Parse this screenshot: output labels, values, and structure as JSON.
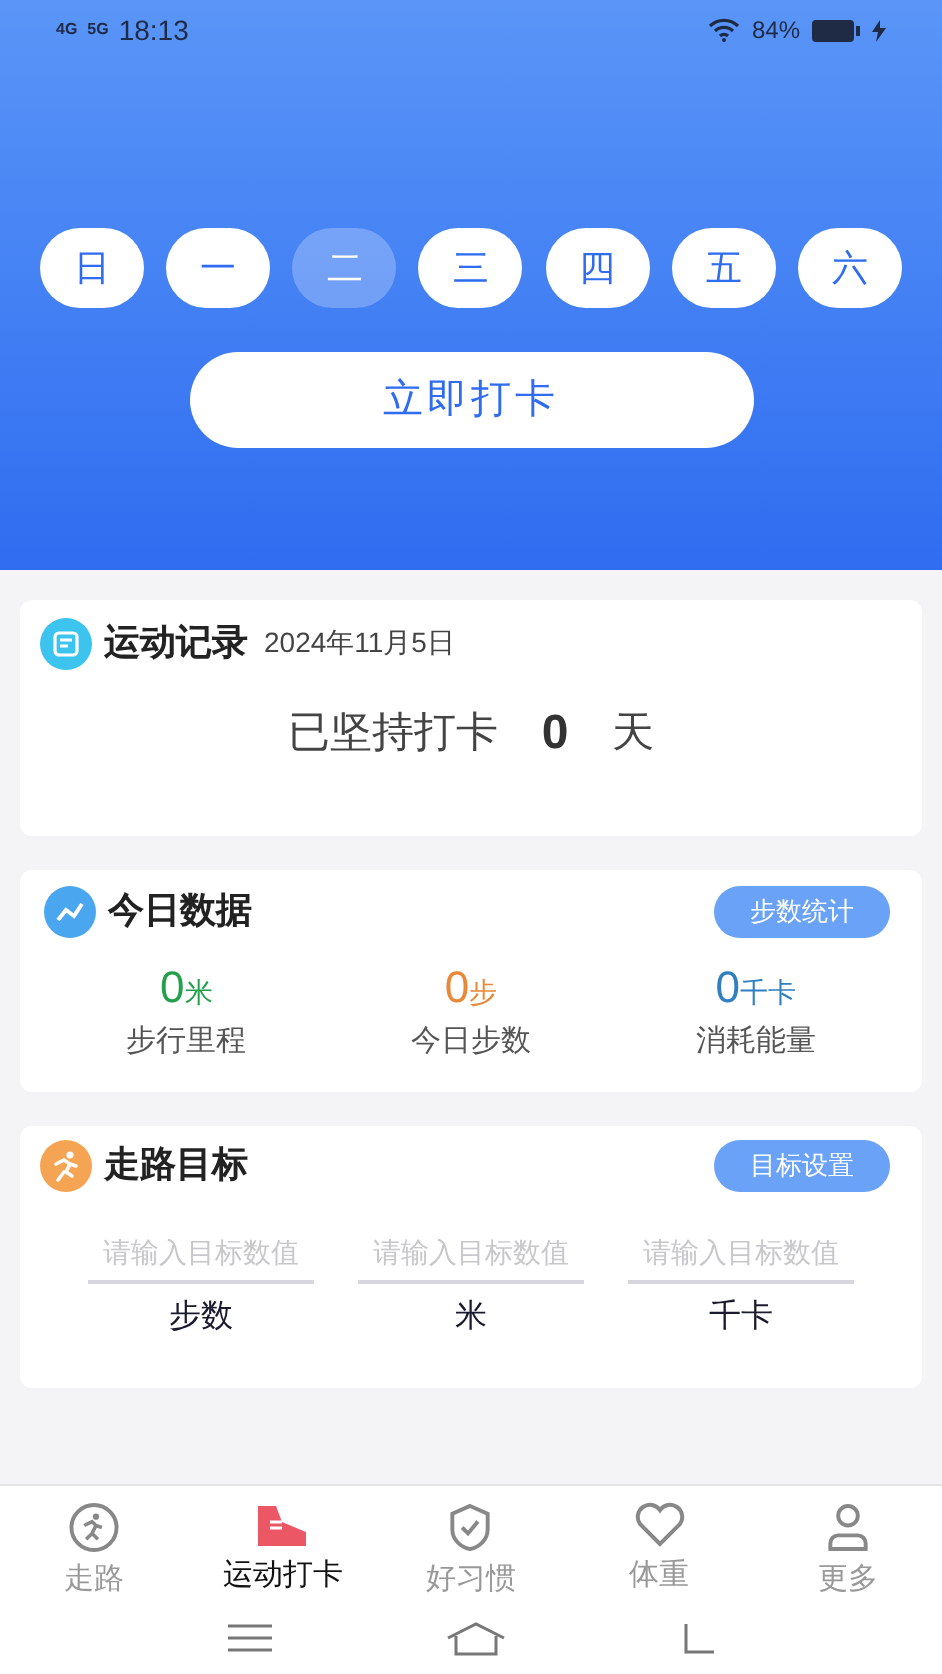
{
  "status_bar": {
    "network_1": "4G",
    "network_2": "5G",
    "time": "18:13",
    "battery": "84%"
  },
  "week_days": [
    {
      "label": "日",
      "selected": false
    },
    {
      "label": "一",
      "selected": false
    },
    {
      "label": "二",
      "selected": true
    },
    {
      "label": "三",
      "selected": false
    },
    {
      "label": "四",
      "selected": false
    },
    {
      "label": "五",
      "selected": false
    },
    {
      "label": "六",
      "selected": false
    }
  ],
  "checkin_button": "立即打卡",
  "record_card": {
    "title": "运动记录",
    "date": "2024年11月5日",
    "streak_label": "已坚持打卡",
    "streak_value": "0",
    "streak_unit": "天"
  },
  "today_card": {
    "title": "今日数据",
    "button": "步数统计",
    "stats": [
      {
        "value": "0",
        "unit": "米",
        "label": "步行里程",
        "color": "#22a04b"
      },
      {
        "value": "0",
        "unit": "步",
        "label": "今日步数",
        "color": "#e8893a"
      },
      {
        "value": "0",
        "unit": "千卡",
        "label": "消耗能量",
        "color": "#2f7fc1"
      }
    ]
  },
  "goal_card": {
    "title": "走路目标",
    "button": "目标设置",
    "fields": [
      {
        "placeholder": "请输入目标数值",
        "unit": "步数"
      },
      {
        "placeholder": "请输入目标数值",
        "unit": "米"
      },
      {
        "placeholder": "请输入目标数值",
        "unit": "千卡"
      }
    ]
  },
  "tab_bar": [
    {
      "kind": "walk",
      "label": "走路",
      "selected": false
    },
    {
      "kind": "shoe",
      "label": "运动打卡",
      "selected": true
    },
    {
      "kind": "check",
      "label": "好习惯",
      "selected": false
    },
    {
      "kind": "heart",
      "label": "体重",
      "selected": false
    },
    {
      "kind": "person",
      "label": "更多",
      "selected": false
    }
  ]
}
